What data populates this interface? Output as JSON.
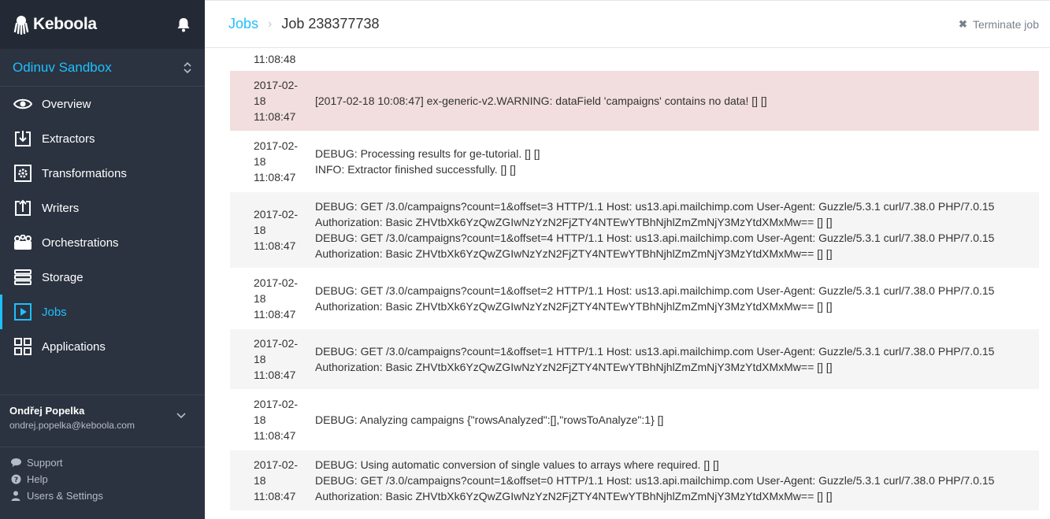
{
  "sidebar": {
    "brand": "Keboola",
    "project": "Odinuv Sandbox",
    "nav": [
      {
        "label": "Overview",
        "icon": "eye-icon",
        "active": false
      },
      {
        "label": "Extractors",
        "icon": "extractor-icon",
        "active": false
      },
      {
        "label": "Transformations",
        "icon": "gear-icon",
        "active": false
      },
      {
        "label": "Writers",
        "icon": "writer-icon",
        "active": false
      },
      {
        "label": "Orchestrations",
        "icon": "orchestration-icon",
        "active": false
      },
      {
        "label": "Storage",
        "icon": "storage-icon",
        "active": false
      },
      {
        "label": "Jobs",
        "icon": "play-icon",
        "active": true
      },
      {
        "label": "Applications",
        "icon": "grid-icon",
        "active": false
      }
    ],
    "user": {
      "name": "Ondřej Popelka",
      "email": "ondrej.popelka@keboola.com"
    },
    "footer": [
      {
        "label": "Support",
        "icon": "chat-icon"
      },
      {
        "label": "Help",
        "icon": "help-icon"
      },
      {
        "label": "Users & Settings",
        "icon": "user-icon"
      }
    ]
  },
  "header": {
    "crumb_link": "Jobs",
    "crumb_separator": "›",
    "crumb_current": "Job 238377738",
    "terminate_label": "Terminate job"
  },
  "log": {
    "top_partial_time": "11:08:48",
    "rows": [
      {
        "style": "warn",
        "date": "2017-02-",
        "day": "18",
        "time": "11:08:47",
        "lines": [
          "[2017-02-18 10:08:47] ex-generic-v2.WARNING: dataField 'campaigns' contains no data! [] []"
        ]
      },
      {
        "style": "even",
        "date": "2017-02-",
        "day": "18",
        "time": "11:08:47",
        "lines": [
          "DEBUG: Processing results for ge-tutorial. [] []",
          "INFO: Extractor finished successfully. [] []"
        ]
      },
      {
        "style": "odd",
        "date": "2017-02-",
        "day": "18",
        "time": "11:08:47",
        "lines": [
          "DEBUG: GET /3.0/campaigns?count=1&offset=3 HTTP/1.1 Host: us13.api.mailchimp.com User-Agent: Guzzle/5.3.1 curl/7.38.0 PHP/7.0.15",
          "Authorization: Basic ZHVtbXk6YzQwZGIwNzYzN2FjZTY4NTEwYTBhNjhlZmZmNjY3MzYtdXMxMw== [] []",
          "DEBUG: GET /3.0/campaigns?count=1&offset=4 HTTP/1.1 Host: us13.api.mailchimp.com User-Agent: Guzzle/5.3.1 curl/7.38.0 PHP/7.0.15",
          "Authorization: Basic ZHVtbXk6YzQwZGIwNzYzN2FjZTY4NTEwYTBhNjhlZmZmNjY3MzYtdXMxMw== [] []"
        ]
      },
      {
        "style": "even",
        "date": "2017-02-",
        "day": "18",
        "time": "11:08:47",
        "lines": [
          "DEBUG: GET /3.0/campaigns?count=1&offset=2 HTTP/1.1 Host: us13.api.mailchimp.com User-Agent: Guzzle/5.3.1 curl/7.38.0 PHP/7.0.15",
          "Authorization: Basic ZHVtbXk6YzQwZGIwNzYzN2FjZTY4NTEwYTBhNjhlZmZmNjY3MzYtdXMxMw== [] []"
        ]
      },
      {
        "style": "odd",
        "date": "2017-02-",
        "day": "18",
        "time": "11:08:47",
        "lines": [
          "DEBUG: GET /3.0/campaigns?count=1&offset=1 HTTP/1.1 Host: us13.api.mailchimp.com User-Agent: Guzzle/5.3.1 curl/7.38.0 PHP/7.0.15",
          "Authorization: Basic ZHVtbXk6YzQwZGIwNzYzN2FjZTY4NTEwYTBhNjhlZmZmNjY3MzYtdXMxMw== [] []"
        ]
      },
      {
        "style": "even",
        "date": "2017-02-",
        "day": "18",
        "time": "11:08:47",
        "lines": [
          "DEBUG: Analyzing campaigns {\"rowsAnalyzed\":[],\"rowsToAnalyze\":1} []"
        ]
      },
      {
        "style": "odd",
        "date": "2017-02-",
        "day": "18",
        "time": "11:08:47",
        "lines": [
          "DEBUG: Using automatic conversion of single values to arrays where required. [] []",
          "DEBUG: GET /3.0/campaigns?count=1&offset=0 HTTP/1.1 Host: us13.api.mailchimp.com User-Agent: Guzzle/5.3.1 curl/7.38.0 PHP/7.0.15",
          "Authorization: Basic ZHVtbXk6YzQwZGIwNzYzN2FjZTY4NTEwYTBhNjhlZmZmNjY3MzYtdXMxMw== [] []"
        ]
      },
      {
        "style": "even",
        "date": "2017-02-",
        "day": "",
        "time": "",
        "lines": []
      }
    ]
  },
  "colors": {
    "accent": "#1ec0ff",
    "sidebar_bg": "#2b3340",
    "warn_bg": "#f2dede",
    "odd_bg": "#f5f5f6"
  }
}
